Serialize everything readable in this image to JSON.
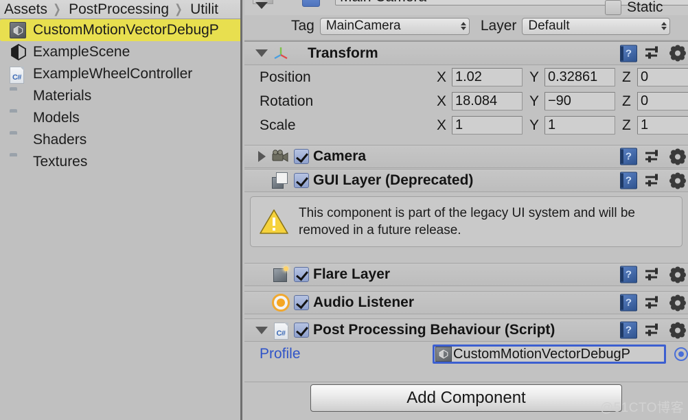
{
  "project": {
    "breadcrumb": [
      "Assets",
      "PostProcessing",
      "Utilit"
    ],
    "separator": "❯",
    "items": [
      {
        "label": "CustomMotionVectorDebugP",
        "icon": "unity-asset-icon",
        "selected": true
      },
      {
        "label": "ExampleScene",
        "icon": "unity-scene-icon",
        "selected": false
      },
      {
        "label": "ExampleWheelController",
        "icon": "csharp-script-icon",
        "selected": false
      },
      {
        "label": "Materials",
        "icon": "folder-icon",
        "selected": false
      },
      {
        "label": "Models",
        "icon": "folder-icon",
        "selected": false
      },
      {
        "label": "Shaders",
        "icon": "folder-icon",
        "selected": false
      },
      {
        "label": "Textures",
        "icon": "folder-icon",
        "selected": false
      }
    ]
  },
  "inspector": {
    "gameobject": {
      "name": "Main Camera",
      "active": true,
      "static_label": "Static",
      "static_checked": false,
      "tag_label": "Tag",
      "tag_value": "MainCamera",
      "layer_label": "Layer",
      "layer_value": "Default"
    },
    "transform": {
      "title": "Transform",
      "expanded": true,
      "rows": [
        {
          "label": "Position",
          "x": "1.02",
          "y": "0.32861",
          "z": "0"
        },
        {
          "label": "Rotation",
          "x": "18.084",
          "y": "−90",
          "z": "0"
        },
        {
          "label": "Scale",
          "x": "1",
          "y": "1",
          "z": "1"
        }
      ],
      "axis": {
        "x": "X",
        "y": "Y",
        "z": "Z"
      }
    },
    "components": [
      {
        "title": "Camera",
        "enabled": true,
        "expanded": false,
        "has_foldout": true,
        "icon": "camera-icon"
      },
      {
        "title": "GUI Layer (Deprecated)",
        "enabled": true,
        "expanded": false,
        "has_foldout": false,
        "icon": "gui-layer-icon"
      },
      {
        "title": "Flare Layer",
        "enabled": true,
        "expanded": false,
        "has_foldout": false,
        "icon": "flare-layer-icon"
      },
      {
        "title": "Audio Listener",
        "enabled": true,
        "expanded": false,
        "has_foldout": false,
        "icon": "audio-listener-icon"
      },
      {
        "title": "Post Processing Behaviour (Script)",
        "enabled": true,
        "expanded": true,
        "has_foldout": true,
        "icon": "csharp-script-icon"
      }
    ],
    "gui_layer_warning": "This component is part of the legacy UI system and will be removed in a future release.",
    "post_processing": {
      "profile_label": "Profile",
      "profile_value": "CustomMotionVectorDebugP"
    },
    "add_component_label": "Add Component",
    "tooltips": {
      "help": "?",
      "preset": "preset-icon",
      "gear": "gear-icon"
    }
  },
  "watermark": "@51CTO博客",
  "colors": {
    "selection_yellow": "#e8df4f",
    "panel_gray": "#c2c2c2",
    "link_blue": "#3054c8",
    "focus_blue": "#3c5fd0",
    "checkbox_blue": "#8fa1cd",
    "audio_orange": "#f5a623"
  }
}
